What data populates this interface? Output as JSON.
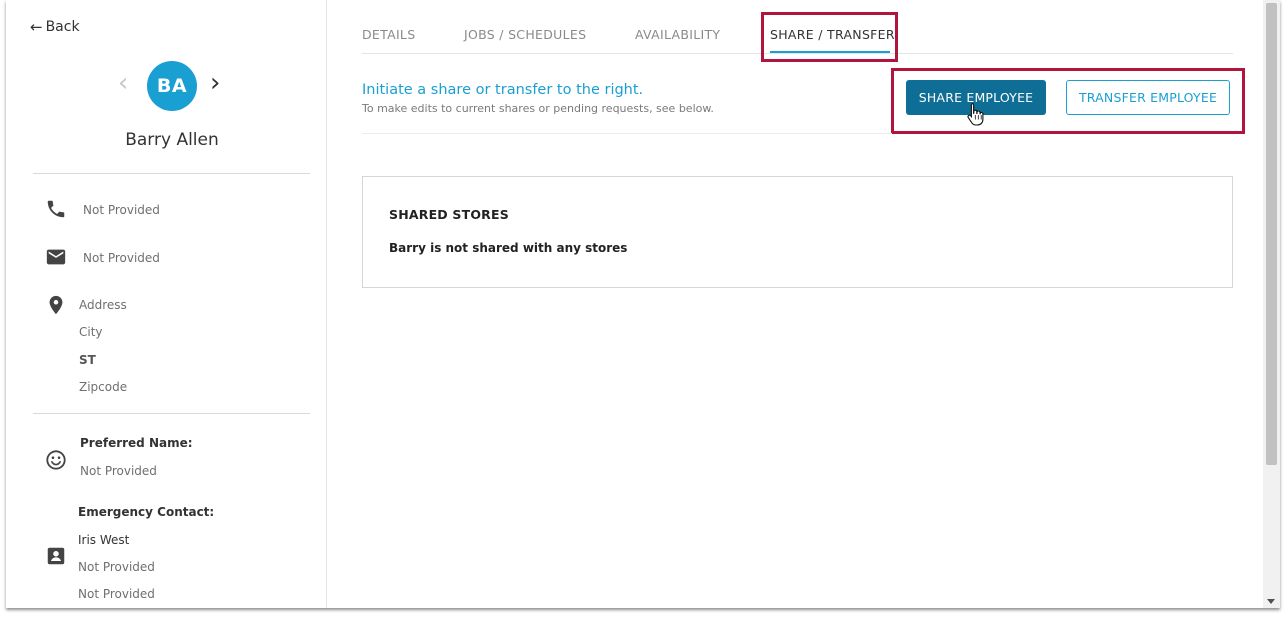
{
  "sidebar": {
    "back_label": "Back",
    "avatar_initials": "BA",
    "employee_name": "Barry Allen",
    "phone": "Not Provided",
    "email": "Not Provided",
    "address": {
      "line1": "Address",
      "city": "City",
      "state": "ST",
      "zip": "Zipcode"
    },
    "preferred_name_label": "Preferred Name:",
    "preferred_name_value": "Not Provided",
    "emergency_contact_label": "Emergency Contact:",
    "emergency_contact_name": "Iris West",
    "emergency_contact_line2": "Not Provided",
    "emergency_contact_line3": "Not Provided",
    "icons": [
      "phone-icon",
      "mail-icon",
      "location-pin-icon",
      "smiley-icon",
      "contact-card-icon"
    ]
  },
  "tabs": [
    {
      "label": "DETAILS",
      "active": false
    },
    {
      "label": "JOBS / SCHEDULES",
      "active": false
    },
    {
      "label": "AVAILABILITY",
      "active": false
    },
    {
      "label": "SHARE / TRANSFER",
      "active": true
    }
  ],
  "main": {
    "prompt_title": "Initiate a share or transfer to the right.",
    "prompt_subtitle": "To make edits to current shares or pending requests, see below.",
    "share_button_label": "SHARE EMPLOYEE",
    "transfer_button_label": "TRANSFER EMPLOYEE",
    "shared_stores_title": "SHARED STORES",
    "shared_stores_message": "Barry is not shared with any stores"
  },
  "colors": {
    "accent": "#1a9fd3",
    "primary_button": "#0f6e95",
    "highlight": "#b0163d"
  }
}
